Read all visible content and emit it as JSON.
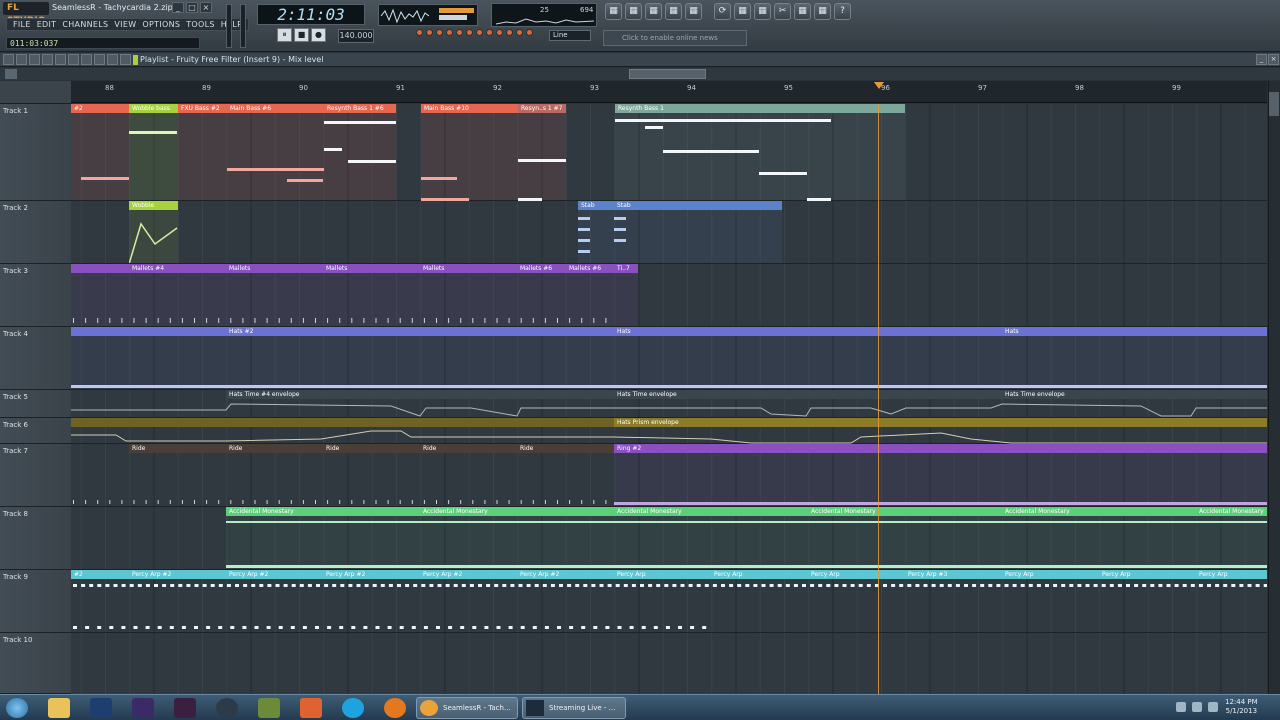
{
  "window": {
    "logo": "FL STUDIO",
    "title": "SeamlessR - Tachycardia 2.zip",
    "buttons": [
      "_",
      "□",
      "×"
    ]
  },
  "menu": [
    "FILE",
    "EDIT",
    "CHANNELS",
    "VIEW",
    "OPTIONS",
    "TOOLS",
    "HELP"
  ],
  "hint": "011:03:037",
  "lcd_time": "2:11:03",
  "transport": {
    "play": "▶",
    "pause": "⏸",
    "stop": "■",
    "rec": "●",
    "tempo": "140.000"
  },
  "line_mode": "Line",
  "news": "Click to enable online news",
  "cpu": {
    "a": "25",
    "b": "694"
  },
  "top_icons": [
    "▦",
    "▦",
    "▦",
    "▦",
    "▦",
    "▦",
    "⟳",
    "▦",
    "▦",
    "✂",
    "▦",
    "▦",
    "?"
  ],
  "playlist": {
    "title": "Playlist - Fruity Free Filter (Insert 9) - Mix level"
  },
  "bars": [
    {
      "n": "88"
    },
    {
      "n": "89"
    },
    {
      "n": "90"
    },
    {
      "n": "91"
    },
    {
      "n": "92"
    },
    {
      "n": "93"
    },
    {
      "n": "94"
    },
    {
      "n": "95"
    },
    {
      "n": "96"
    },
    {
      "n": "97"
    },
    {
      "n": "98"
    },
    {
      "n": "99"
    }
  ],
  "tracks": [
    "Track 1",
    "Track 2",
    "Track 3",
    "Track 4",
    "Track 5",
    "Track 6",
    "Track 7",
    "Track 8",
    "Track 9",
    "Track 10"
  ],
  "clips": {
    "t1": [
      {
        "label": "#2",
        "c": "#e7664f"
      },
      {
        "label": "Wobble bass",
        "c": "#a6d23d"
      },
      {
        "label": "FXU Bass #2",
        "c": "#e7664f"
      },
      {
        "label": "Main Bass #6",
        "c": "#e7664f"
      },
      {
        "label": "Resynth Bass 1 #6",
        "c": "#e7664f"
      },
      {
        "label": "Main Bass #10",
        "c": "#e7664f"
      },
      {
        "label": "Resyn..s 1 #7",
        "c": "#e7664f"
      },
      {
        "label": "Resynth Bass 1",
        "c": "#7ea79b"
      }
    ],
    "t2": [
      {
        "label": "Wobble",
        "c": "#a6d23d"
      },
      {
        "label": "Stab",
        "c": "#5b83c9"
      },
      {
        "label": "Stab",
        "c": "#5b83c9"
      }
    ],
    "t3": [
      {
        "label": "Mallets #4",
        "c": "#8a50c0"
      },
      {
        "label": "Mallets",
        "c": "#8a50c0"
      },
      {
        "label": "Mallets",
        "c": "#8a50c0"
      },
      {
        "label": "Mallets",
        "c": "#8a50c0"
      },
      {
        "label": "Mallets #6",
        "c": "#8a50c0"
      },
      {
        "label": "Mallets #6",
        "c": "#8a50c0"
      },
      {
        "label": "Ti..7",
        "c": "#8a50c0"
      }
    ],
    "t4": [
      {
        "label": "Hats #2",
        "c": "#6c72d4"
      },
      {
        "label": "Hats",
        "c": "#6c72d4"
      },
      {
        "label": "Hats",
        "c": "#6c72d4"
      }
    ],
    "t5": [
      {
        "label": "Hats Time #4 envelope",
        "c": "#3b454c"
      },
      {
        "label": "Hats Time envelope",
        "c": "#3b454c"
      },
      {
        "label": "Hats Time envelope",
        "c": "#3b454c"
      }
    ],
    "t6": [
      {
        "label": "Hats Prism envelope",
        "c": "#8c7c2a"
      }
    ],
    "t7": [
      {
        "label": "Ride",
        "c": "#4a3f36"
      },
      {
        "label": "Ride",
        "c": "#4a3f36"
      },
      {
        "label": "Ride",
        "c": "#4a3f36"
      },
      {
        "label": "Ride",
        "c": "#4a3f36"
      },
      {
        "label": "Ride",
        "c": "#4a3f36"
      },
      {
        "label": "Ring #2",
        "c": "#8a50c0"
      }
    ],
    "t8": [
      {
        "label": "Accidental Monestary",
        "c": "#5ccf7a"
      },
      {
        "label": "Accidental Monestary",
        "c": "#5ccf7a"
      },
      {
        "label": "Accidental Monestary",
        "c": "#5ccf7a"
      },
      {
        "label": "Accidental Monestary",
        "c": "#5ccf7a"
      },
      {
        "label": "Accidental Monestary",
        "c": "#5ccf7a"
      },
      {
        "label": "Accidental Monestary",
        "c": "#5ccf7a"
      }
    ],
    "t9": [
      {
        "label": "#2",
        "c": "#5cc6d3"
      },
      {
        "label": "Percy Arp #2",
        "c": "#5cc6d3"
      },
      {
        "label": "Percy Arp #2",
        "c": "#5cc6d3"
      },
      {
        "label": "Percy Arp #2",
        "c": "#5cc6d3"
      },
      {
        "label": "Percy Arp #2",
        "c": "#5cc6d3"
      },
      {
        "label": "Percy Arp #2",
        "c": "#5cc6d3"
      },
      {
        "label": "Percy Arp",
        "c": "#5cc6d3"
      },
      {
        "label": "Percy Arp",
        "c": "#5cc6d3"
      },
      {
        "label": "Percy Arp",
        "c": "#5cc6d3"
      },
      {
        "label": "Percy Arp #3",
        "c": "#5cc6d3"
      },
      {
        "label": "Percy Arp",
        "c": "#5cc6d3"
      },
      {
        "label": "Percy Arp",
        "c": "#5cc6d3"
      },
      {
        "label": "Percy Arp",
        "c": "#5cc6d3"
      }
    ]
  },
  "taskbar": {
    "task1": "SeamlessR - Tach...",
    "task2": "Streaming Live - ...",
    "time": "12:44 PM",
    "date": "5/1/2013"
  }
}
